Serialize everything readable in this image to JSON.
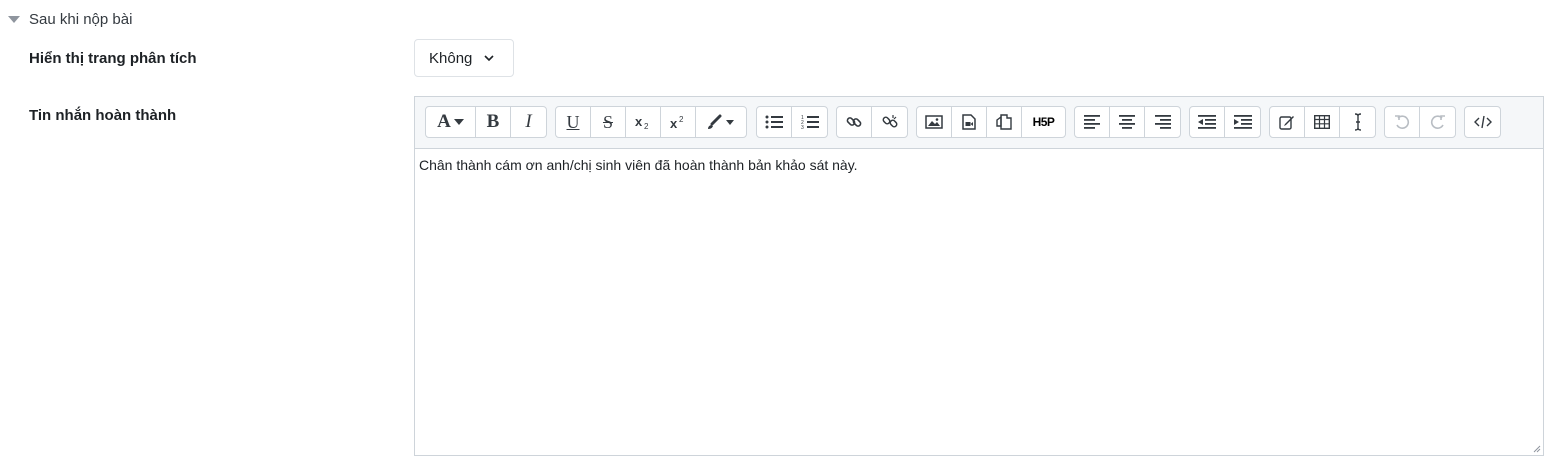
{
  "section": {
    "title": "Sau khi nộp bài"
  },
  "fields": {
    "analysis_label": "Hiển thị trang phân tích",
    "analysis_value": "Không",
    "completion_label": "Tin nhắn hoàn thành"
  },
  "toolbar": {
    "font_label": "A",
    "bold_label": "B",
    "italic_label": "I",
    "underline_label": "U",
    "strike_label": "S",
    "h5p_label": "H5P"
  },
  "editor": {
    "content": "Chân thành cám ơn anh/chị sinh viên đã hoàn thành bản khảo sát này."
  },
  "colors": {
    "border": "#ced4da",
    "toolbar_bg": "#f5f7f9",
    "text": "#1d2125"
  }
}
